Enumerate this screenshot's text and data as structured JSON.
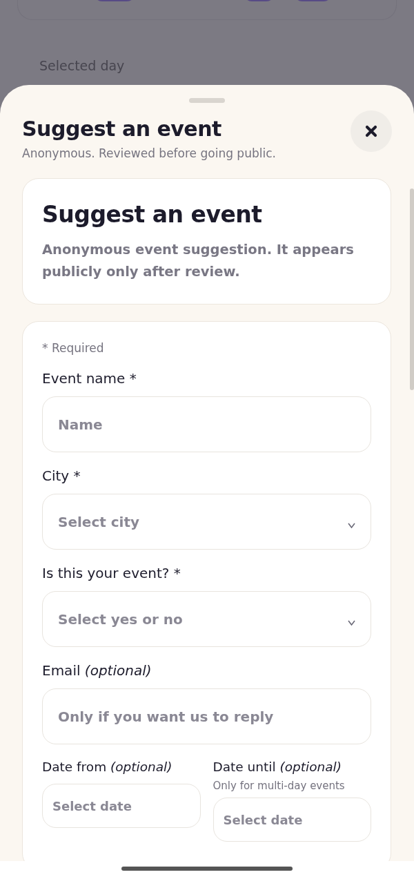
{
  "background": {
    "label": "Selected day"
  },
  "sheet": {
    "title": "Suggest an event",
    "subtitle": "Anonymous. Reviewed before going public."
  },
  "intro": {
    "heading": "Suggest an event",
    "text": "Anonymous event suggestion. It appears publicly only after review."
  },
  "form": {
    "required_note": "* Required",
    "fields": [
      {
        "kind": "text",
        "label": "Event name *",
        "placeholder": "Name"
      },
      {
        "kind": "select",
        "label": "City *",
        "placeholder": "Select city"
      },
      {
        "kind": "select",
        "label": "Is this your event? *",
        "placeholder": "Select yes or no"
      },
      {
        "kind": "text",
        "label": "Email *(optional)*",
        "placeholder": "Only if you want us to reply"
      }
    ],
    "date_fields": [
      {
        "label": "Date from *(optional)*",
        "placeholder": "Select date"
      },
      {
        "label": "Date until *(optional)*",
        "hint": "Only for multi-day events",
        "placeholder": "Select date"
      }
    ]
  }
}
